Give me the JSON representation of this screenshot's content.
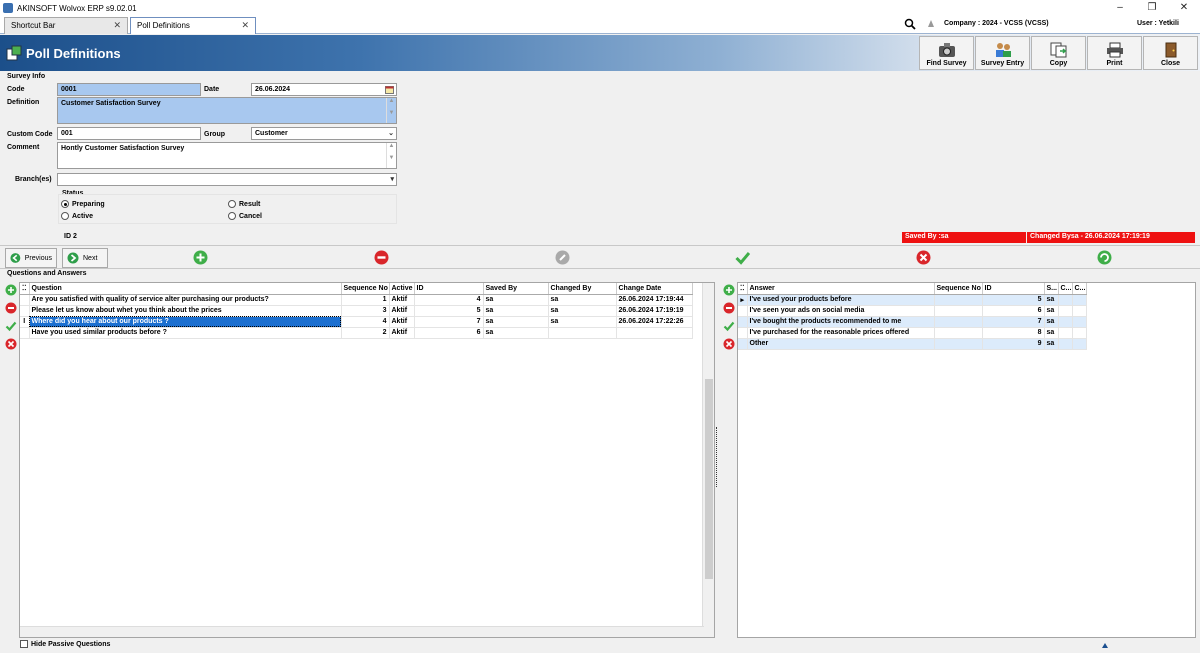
{
  "window": {
    "title": "AKINSOFT Wolvox ERP s9.02.01",
    "controls": [
      "–",
      "❐",
      "✕"
    ]
  },
  "tabs": [
    {
      "label": "Shortcut Bar",
      "close": "✕"
    },
    {
      "label": "Poll Definitions",
      "close": "✕"
    }
  ],
  "company": "Company : 2024 - VCSS (VCSS)",
  "user": "User : Yetkili",
  "header": {
    "title": "Poll Definitions"
  },
  "toolbar": {
    "find_survey": "Find Survey",
    "survey_entry": "Survey Entry",
    "copy": "Copy",
    "print": "Print",
    "close": "Close"
  },
  "survey": {
    "section": "Survey Info",
    "code_label": "Code",
    "code": "0001",
    "date_label": "Date",
    "date": "26.06.2024",
    "definition_label": "Definition",
    "definition": "Customer Satisfaction Survey",
    "custom_code_label": "Custom Code",
    "custom_code": "001",
    "group_label": "Group",
    "group": "Customer",
    "comment_label": "Comment",
    "comment": "Hontly Customer Satisfaction Survey",
    "branches_label": "Branch(es)",
    "branches": "",
    "status_label": "Status",
    "status_options": [
      "Preparing",
      "Result",
      "Active",
      "Cancel"
    ],
    "status_selected": "Preparing",
    "id_label": "ID",
    "id": "2"
  },
  "audit": {
    "saved_by": "Saved By :sa",
    "changed_by": "Changed Bysa - 26.06.2024 17:19:19"
  },
  "nav": {
    "previous": "Previous",
    "next": "Next"
  },
  "questions_section": "Questions and Answers",
  "questions": {
    "columns": [
      "Question",
      "Sequence No",
      "Active",
      "ID",
      "Saved By",
      "Changed By",
      "Change Date"
    ],
    "rows": [
      {
        "question": "Are you satisfied with quality of service alter purchasing our products?",
        "seq": "1",
        "active": "Aktif",
        "id": "4",
        "saved_by": "sa",
        "changed_by": "sa",
        "change_date": "26.06.2024 17:19:44"
      },
      {
        "question": "Please let us know about whet you think about the prices",
        "seq": "3",
        "active": "Aktif",
        "id": "5",
        "saved_by": "sa",
        "changed_by": "sa",
        "change_date": "26.06.2024 17:19:19"
      },
      {
        "question": "Where did you hear about our products ?",
        "seq": "4",
        "active": "Aktif",
        "id": "7",
        "saved_by": "sa",
        "changed_by": "sa",
        "change_date": "26.06.2024 17:22:26"
      },
      {
        "question": "Have you used similar products before ?",
        "seq": "2",
        "active": "Aktif",
        "id": "6",
        "saved_by": "sa",
        "changed_by": "",
        "change_date": ""
      }
    ]
  },
  "answers": {
    "columns": [
      "Answer",
      "Sequence No",
      "ID",
      "S...",
      "C...",
      "C..."
    ],
    "rows": [
      {
        "answer": "I've used your products before",
        "seq": "",
        "id": "5",
        "s": "sa"
      },
      {
        "answer": "I've seen your ads on social media",
        "seq": "",
        "id": "6",
        "s": "sa"
      },
      {
        "answer": "I've bought the products recommended to me",
        "seq": "",
        "id": "7",
        "s": "sa"
      },
      {
        "answer": "I've purchased for the reasonable prices offered",
        "seq": "",
        "id": "8",
        "s": "sa"
      },
      {
        "answer": "Other",
        "seq": "",
        "id": "9",
        "s": "sa"
      }
    ]
  },
  "footer": {
    "hide_passive": "Hide Passive Questions"
  },
  "colors": {
    "accent": "#1c4f8a",
    "selection": "#1b6fd0",
    "audit_red": "#ee1111",
    "field_blue": "#a8c8ef"
  }
}
